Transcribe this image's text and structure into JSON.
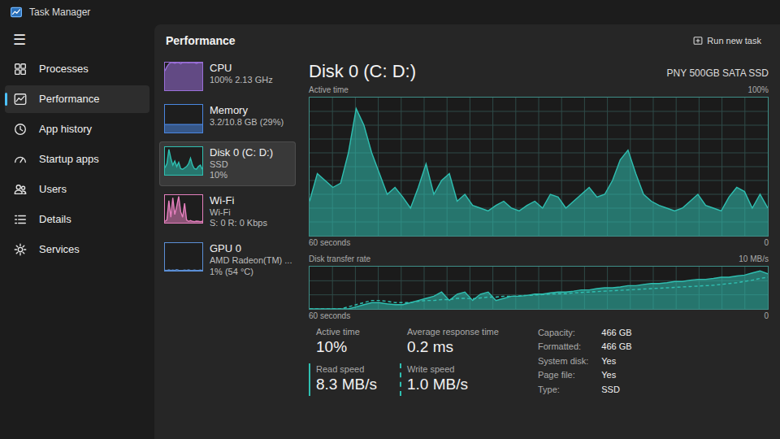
{
  "window": {
    "title": "Task Manager",
    "menu_icon": "☰"
  },
  "sidebar": {
    "items": [
      {
        "label": "Processes",
        "selected": false
      },
      {
        "label": "Performance",
        "selected": true
      },
      {
        "label": "App history",
        "selected": false
      },
      {
        "label": "Startup apps",
        "selected": false
      },
      {
        "label": "Users",
        "selected": false
      },
      {
        "label": "Details",
        "selected": false
      },
      {
        "label": "Services",
        "selected": false
      }
    ]
  },
  "page": {
    "title": "Performance",
    "run_button": "Run new task"
  },
  "devices": [
    {
      "name": "CPU",
      "lines": [
        "100% 2.13 GHz"
      ],
      "selected": false,
      "color": "#9a6fd8",
      "history": [
        70,
        85,
        95,
        100,
        100,
        98,
        100,
        100,
        96,
        100,
        100,
        100,
        99,
        100,
        100,
        100,
        97,
        100,
        100,
        100
      ]
    },
    {
      "name": "Memory",
      "lines": [
        "3.2/10.8 GB (29%)"
      ],
      "selected": false,
      "color": "#4a86e0",
      "history": [
        29,
        29,
        29,
        29,
        29,
        29,
        29,
        29,
        29,
        29,
        29,
        29,
        29,
        29,
        29,
        29,
        29,
        29,
        29,
        29
      ]
    },
    {
      "name": "Disk 0 (C: D:)",
      "lines": [
        "SSD",
        "10%"
      ],
      "selected": true,
      "color": "#2fbfb1",
      "history": [
        25,
        40,
        92,
        60,
        35,
        50,
        30,
        45,
        22,
        20,
        25,
        30,
        40,
        60,
        35,
        22,
        20,
        30,
        35,
        20
      ]
    },
    {
      "name": "Wi-Fi",
      "lines": [
        "Wi-Fi",
        "S: 0 R: 0 Kbps"
      ],
      "selected": false,
      "color": "#e47fbd",
      "history": [
        5,
        10,
        80,
        20,
        90,
        30,
        60,
        95,
        40,
        20,
        70,
        10,
        5,
        8,
        5,
        4,
        6,
        5,
        4,
        5
      ]
    },
    {
      "name": "GPU 0",
      "lines": [
        "AMD Radeon(TM) ...",
        "1% (54 °C)"
      ],
      "selected": false,
      "color": "#5b8fd6",
      "history": [
        2,
        1,
        3,
        1,
        2,
        1,
        4,
        2,
        1,
        1,
        2,
        1,
        3,
        1,
        1,
        2,
        1,
        1,
        2,
        1
      ]
    }
  ],
  "detail": {
    "title": "Disk 0 (C: D:)",
    "model": "PNY 500GB SATA SSD",
    "chart1": {
      "label": "Active time",
      "max": "100%",
      "axis_left": "60 seconds",
      "axis_right": "0",
      "values": [
        25,
        45,
        40,
        35,
        38,
        60,
        92,
        80,
        60,
        45,
        30,
        35,
        28,
        20,
        35,
        52,
        30,
        40,
        45,
        25,
        30,
        22,
        20,
        18,
        22,
        25,
        20,
        18,
        22,
        25,
        20,
        30,
        28,
        20,
        25,
        30,
        35,
        28,
        30,
        40,
        55,
        62,
        45,
        30,
        25,
        22,
        20,
        18,
        20,
        25,
        30,
        22,
        20,
        18,
        28,
        35,
        32,
        20,
        30,
        20
      ]
    },
    "chart2": {
      "label": "Disk transfer rate",
      "max": "10 MB/s",
      "axis_left": "60 seconds",
      "axis_right": "0",
      "read": [
        0,
        0,
        0,
        0,
        0,
        0,
        0.5,
        1,
        1.5,
        1.5,
        1.2,
        1,
        1,
        1.5,
        2,
        2.5,
        3,
        4,
        2,
        3.5,
        4,
        2,
        3.5,
        4,
        2,
        2.5,
        3,
        3,
        3.2,
        3.5,
        3.5,
        3.8,
        4,
        4,
        4.2,
        4.5,
        4.5,
        4.8,
        5,
        5,
        5.2,
        5.5,
        5.5,
        5.8,
        6,
        6,
        6.2,
        6.5,
        6.5,
        6.8,
        7,
        7,
        7.2,
        7.5,
        7.5,
        7.8,
        8,
        8.5,
        9,
        8.3
      ],
      "write": [
        0,
        0,
        0,
        0,
        0,
        0.5,
        1,
        1.5,
        2,
        2,
        1.8,
        1.5,
        1.5,
        1.5,
        1.8,
        2,
        2,
        2.2,
        2.2,
        2.5,
        2.5,
        2.4,
        2.6,
        2.8,
        2.8,
        3,
        3,
        3.1,
        3.2,
        3.3,
        3.4,
        3.5,
        3.6,
        3.6,
        3.8,
        3.9,
        4,
        4.1,
        4.2,
        4.3,
        4.4,
        4.5,
        4.6,
        4.7,
        4.8,
        4.9,
        5,
        5.1,
        5.2,
        5.3,
        5.4,
        5.5,
        5.6,
        5.8,
        6,
        6.2,
        6.5,
        6.8,
        7.2,
        7.5
      ]
    },
    "stats": [
      {
        "label": "Active time",
        "value": "10%",
        "kind": "plain"
      },
      {
        "label": "Average response time",
        "value": "0.2 ms",
        "kind": "plain"
      },
      {
        "label": "Read speed",
        "value": "8.3 MB/s",
        "kind": "read"
      },
      {
        "label": "Write speed",
        "value": "1.0 MB/s",
        "kind": "write"
      }
    ],
    "properties": [
      {
        "key": "Capacity:",
        "value": "466 GB"
      },
      {
        "key": "Formatted:",
        "value": "466 GB"
      },
      {
        "key": "System disk:",
        "value": "Yes"
      },
      {
        "key": "Page file:",
        "value": "Yes"
      },
      {
        "key": "Type:",
        "value": "SSD"
      }
    ]
  }
}
